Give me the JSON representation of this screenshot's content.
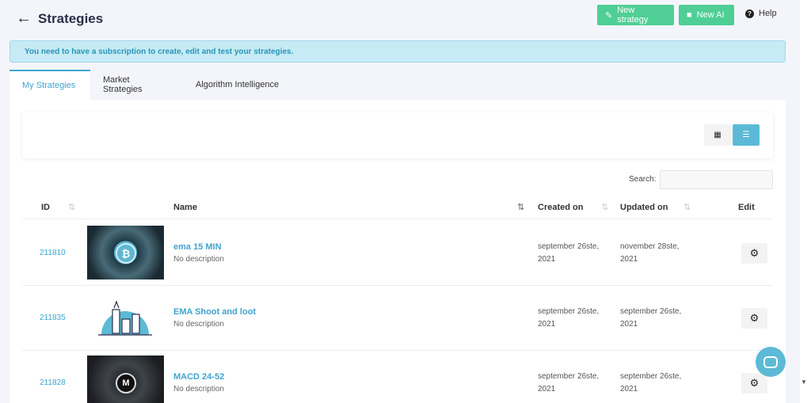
{
  "header": {
    "back_icon": "arrow-left-icon",
    "title": "Strategies",
    "new_strategy_label": "New strategy",
    "new_ai_label": "New AI",
    "help_label": "Help"
  },
  "alert": {
    "text": "You need to have a subscription to create, edit and test your strategies."
  },
  "tabs": [
    {
      "label": "My Strategies",
      "active": true
    },
    {
      "label": "Market Strategies",
      "active": false
    },
    {
      "label": "Algorithm Intelligence",
      "active": false
    }
  ],
  "search": {
    "label": "Search:",
    "value": ""
  },
  "table": {
    "columns": [
      "ID",
      "Name",
      "Created on",
      "Updated on",
      "Edit"
    ],
    "rows": [
      {
        "id": "211810",
        "name": "ema 15 MIN",
        "description": "No description",
        "created": "september 26ste, 2021",
        "updated": "november 28ste, 2021"
      },
      {
        "id": "211835",
        "name": "EMA Shoot and loot",
        "description": "No description",
        "created": "september 26ste, 2021",
        "updated": "september 26ste, 2021"
      },
      {
        "id": "211828",
        "name": "MACD 24-52",
        "description": "No description",
        "created": "september 26ste, 2021",
        "updated": "september 26ste, 2021"
      }
    ]
  },
  "colors": {
    "accent": "#3fa4cf",
    "green": "#4fcf96",
    "alert_bg": "#c6ebf5"
  }
}
